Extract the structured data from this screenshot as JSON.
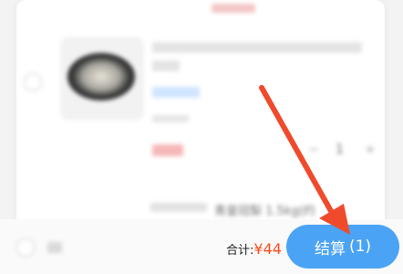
{
  "cart": {
    "item": {
      "title": "",
      "quantity": "1",
      "minus_symbol": "−",
      "plus_symbol": "+"
    },
    "next_item": {
      "title": "青皇冠梨 1.5kg(约"
    }
  },
  "footer": {
    "select_all_label": "",
    "total_label": "合计:",
    "total_amount": "¥44",
    "checkout_label": "结算",
    "checkout_count": "(1)"
  },
  "colors": {
    "accent": "#4aa3f4",
    "price": "#ff4b1f",
    "annotation_arrow": "#f04a2d"
  }
}
